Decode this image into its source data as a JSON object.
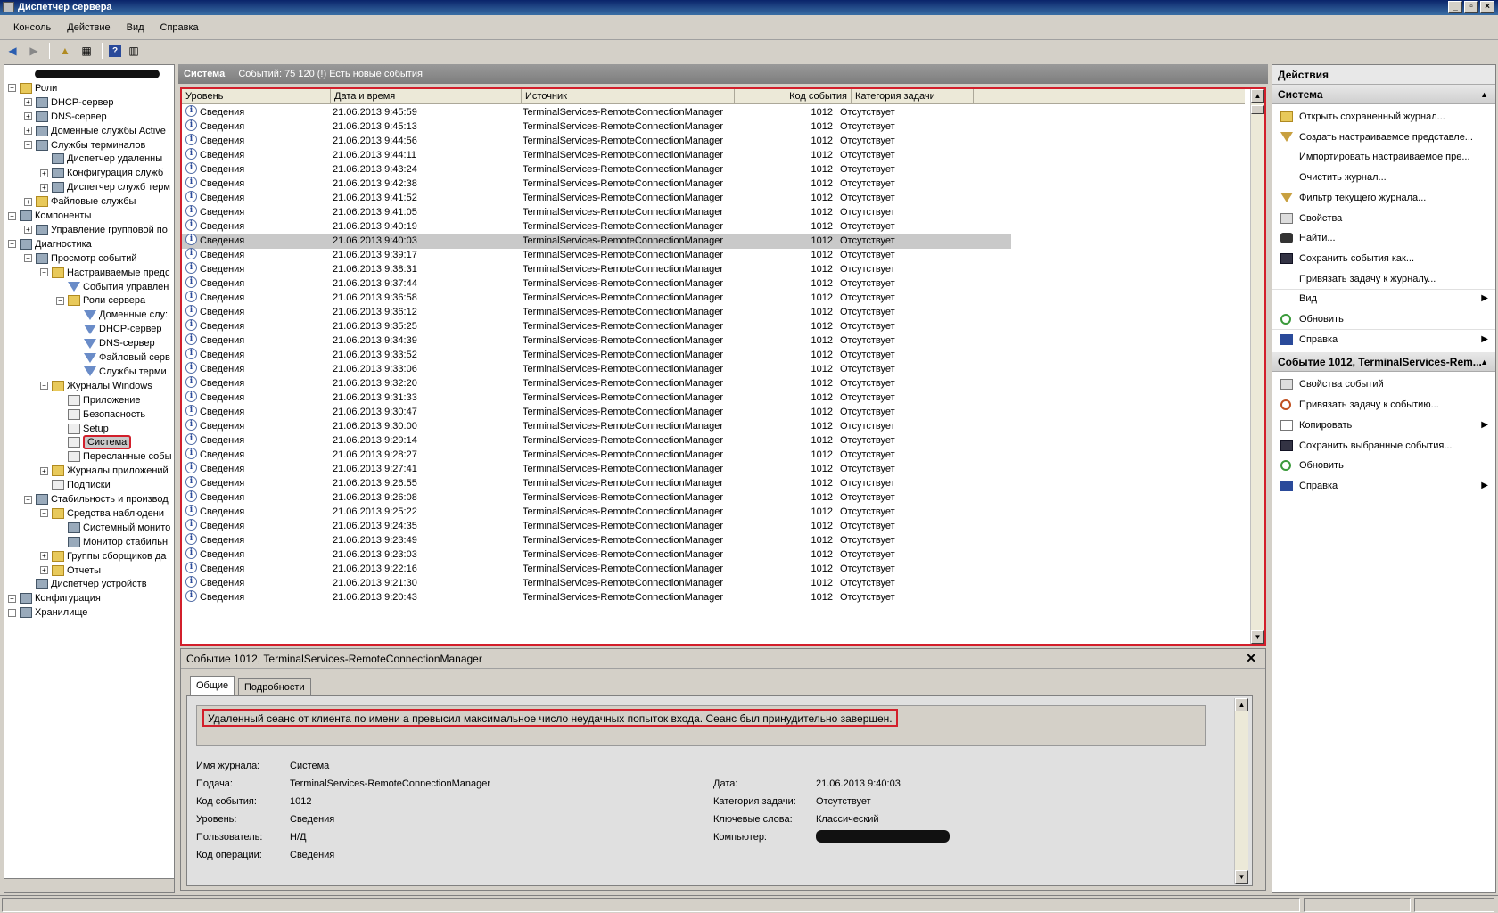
{
  "window": {
    "title": "Диспетчер сервера"
  },
  "menu": [
    "Консоль",
    "Действие",
    "Вид",
    "Справка"
  ],
  "tree": [
    {
      "label": "",
      "depth": 0,
      "pm": "",
      "icon": "server",
      "redacted": true
    },
    {
      "label": "Роли",
      "depth": 0,
      "pm": "−",
      "icon": "folder"
    },
    {
      "label": "DHCP-сервер",
      "depth": 1,
      "pm": "+",
      "icon": "comp"
    },
    {
      "label": "DNS-сервер",
      "depth": 1,
      "pm": "+",
      "icon": "comp"
    },
    {
      "label": "Доменные службы Active",
      "depth": 1,
      "pm": "+",
      "icon": "comp"
    },
    {
      "label": "Службы терминалов",
      "depth": 1,
      "pm": "−",
      "icon": "comp"
    },
    {
      "label": "Диспетчер удаленны",
      "depth": 2,
      "pm": "",
      "icon": "comp"
    },
    {
      "label": "Конфигурация служб",
      "depth": 2,
      "pm": "+",
      "icon": "comp"
    },
    {
      "label": "Диспетчер служб терм",
      "depth": 2,
      "pm": "+",
      "icon": "comp"
    },
    {
      "label": "Файловые службы",
      "depth": 1,
      "pm": "+",
      "icon": "folder"
    },
    {
      "label": "Компоненты",
      "depth": 0,
      "pm": "−",
      "icon": "comp"
    },
    {
      "label": "Управление групповой по",
      "depth": 1,
      "pm": "+",
      "icon": "comp"
    },
    {
      "label": "Диагностика",
      "depth": 0,
      "pm": "−",
      "icon": "comp"
    },
    {
      "label": "Просмотр событий",
      "depth": 1,
      "pm": "−",
      "icon": "comp"
    },
    {
      "label": "Настраиваемые предс",
      "depth": 2,
      "pm": "−",
      "icon": "folder"
    },
    {
      "label": "События управлен",
      "depth": 3,
      "pm": "",
      "icon": "filter"
    },
    {
      "label": "Роли сервера",
      "depth": 3,
      "pm": "−",
      "icon": "folder"
    },
    {
      "label": "Доменные слу:",
      "depth": 4,
      "pm": "",
      "icon": "filter"
    },
    {
      "label": "DHCP-сервер",
      "depth": 4,
      "pm": "",
      "icon": "filter"
    },
    {
      "label": "DNS-сервер",
      "depth": 4,
      "pm": "",
      "icon": "filter"
    },
    {
      "label": "Файловый серв",
      "depth": 4,
      "pm": "",
      "icon": "filter"
    },
    {
      "label": "Службы терми",
      "depth": 4,
      "pm": "",
      "icon": "filter"
    },
    {
      "label": "Журналы Windows",
      "depth": 2,
      "pm": "−",
      "icon": "folder"
    },
    {
      "label": "Приложение",
      "depth": 3,
      "pm": "",
      "icon": "log"
    },
    {
      "label": "Безопасность",
      "depth": 3,
      "pm": "",
      "icon": "log"
    },
    {
      "label": "Setup",
      "depth": 3,
      "pm": "",
      "icon": "log"
    },
    {
      "label": "Система",
      "depth": 3,
      "pm": "",
      "icon": "log",
      "selected": true
    },
    {
      "label": "Пересланные собы",
      "depth": 3,
      "pm": "",
      "icon": "log"
    },
    {
      "label": "Журналы приложений",
      "depth": 2,
      "pm": "+",
      "icon": "folder"
    },
    {
      "label": "Подписки",
      "depth": 2,
      "pm": "",
      "icon": "log"
    },
    {
      "label": "Стабильность и производ",
      "depth": 1,
      "pm": "−",
      "icon": "comp"
    },
    {
      "label": "Средства наблюдени",
      "depth": 2,
      "pm": "−",
      "icon": "folder"
    },
    {
      "label": "Системный монито",
      "depth": 3,
      "pm": "",
      "icon": "comp"
    },
    {
      "label": "Монитор стабильн",
      "depth": 3,
      "pm": "",
      "icon": "comp"
    },
    {
      "label": "Группы сборщиков да",
      "depth": 2,
      "pm": "+",
      "icon": "folder"
    },
    {
      "label": "Отчеты",
      "depth": 2,
      "pm": "+",
      "icon": "folder"
    },
    {
      "label": "Диспетчер устройств",
      "depth": 1,
      "pm": "",
      "icon": "comp"
    },
    {
      "label": "Конфигурация",
      "depth": 0,
      "pm": "+",
      "icon": "comp"
    },
    {
      "label": "Хранилище",
      "depth": 0,
      "pm": "+",
      "icon": "comp"
    }
  ],
  "center_header": {
    "title": "Система",
    "info": "Событий: 75 120 (!) Есть новые события"
  },
  "grid": {
    "columns": [
      "Уровень",
      "Дата и время",
      "Источник",
      "Код события",
      "Категория задачи"
    ],
    "level": "Сведения",
    "source": "TerminalServices-RemoteConnectionManager",
    "event_id": "1012",
    "category": "Отсутствует",
    "times": [
      "21.06.2013 9:45:59",
      "21.06.2013 9:45:13",
      "21.06.2013 9:44:56",
      "21.06.2013 9:44:11",
      "21.06.2013 9:43:24",
      "21.06.2013 9:42:38",
      "21.06.2013 9:41:52",
      "21.06.2013 9:41:05",
      "21.06.2013 9:40:19",
      "21.06.2013 9:40:03",
      "21.06.2013 9:39:17",
      "21.06.2013 9:38:31",
      "21.06.2013 9:37:44",
      "21.06.2013 9:36:58",
      "21.06.2013 9:36:12",
      "21.06.2013 9:35:25",
      "21.06.2013 9:34:39",
      "21.06.2013 9:33:52",
      "21.06.2013 9:33:06",
      "21.06.2013 9:32:20",
      "21.06.2013 9:31:33",
      "21.06.2013 9:30:47",
      "21.06.2013 9:30:00",
      "21.06.2013 9:29:14",
      "21.06.2013 9:28:27",
      "21.06.2013 9:27:41",
      "21.06.2013 9:26:55",
      "21.06.2013 9:26:08",
      "21.06.2013 9:25:22",
      "21.06.2013 9:24:35",
      "21.06.2013 9:23:49",
      "21.06.2013 9:23:03",
      "21.06.2013 9:22:16",
      "21.06.2013 9:21:30",
      "21.06.2013 9:20:43"
    ],
    "selected_index": 9
  },
  "detail": {
    "title": "Событие 1012, TerminalServices-RemoteConnectionManager",
    "tabs": [
      "Общие",
      "Подробности"
    ],
    "message": "Удаленный сеанс от клиента по имени a превысил максимальное число неудачных попыток входа. Сеанс был принудительно завершен.",
    "fields": {
      "log_name_label": "Имя журнала:",
      "log_name": "Система",
      "source_label": "Подача:",
      "source": "TerminalServices-RemoteConnectionManager",
      "event_id_label": "Код события:",
      "event_id": "1012",
      "level_label": "Уровень:",
      "level": "Сведения",
      "user_label": "Пользователь:",
      "user": "Н/Д",
      "opcode_label": "Код операции:",
      "opcode": "Сведения",
      "date_label": "Дата:",
      "date": "21.06.2013 9:40:03",
      "category_label": "Категория задачи:",
      "category": "Отсутствует",
      "keywords_label": "Ключевые слова:",
      "keywords": "Классический",
      "computer_label": "Компьютер:"
    }
  },
  "actions": {
    "header": "Действия",
    "section1": "Система",
    "items1": [
      {
        "label": "Открыть сохраненный журнал...",
        "icon": "open-folder-icon",
        "sub": false
      },
      {
        "label": "Создать настраиваемое представле...",
        "icon": "filter-icon",
        "sub": false
      },
      {
        "label": "Импортировать настраиваемое пре...",
        "icon": "",
        "sub": false
      },
      {
        "label": "Очистить журнал...",
        "icon": "",
        "sub": false
      },
      {
        "label": "Фильтр текущего журнала...",
        "icon": "filter-icon",
        "sub": false
      },
      {
        "label": "Свойства",
        "icon": "properties-icon",
        "sub": false
      },
      {
        "label": "Найти...",
        "icon": "binoculars-icon",
        "sub": false
      },
      {
        "label": "Сохранить события как...",
        "icon": "save-icon",
        "sub": false
      },
      {
        "label": "Привязать задачу к журналу...",
        "icon": "",
        "sub": false
      },
      {
        "label": "Вид",
        "icon": "",
        "sub": true
      },
      {
        "label": "Обновить",
        "icon": "refresh-icon",
        "sub": false
      },
      {
        "label": "Справка",
        "icon": "help-icon",
        "sub": true
      }
    ],
    "section2": "Событие 1012, TerminalServices-Rem...",
    "items2": [
      {
        "label": "Свойства событий",
        "icon": "properties-icon",
        "sub": false
      },
      {
        "label": "Привязать задачу к событию...",
        "icon": "clock-icon",
        "sub": false
      },
      {
        "label": "Копировать",
        "icon": "copy-icon",
        "sub": true
      },
      {
        "label": "Сохранить выбранные события...",
        "icon": "save-icon",
        "sub": false
      },
      {
        "label": "Обновить",
        "icon": "refresh-icon",
        "sub": false
      },
      {
        "label": "Справка",
        "icon": "help-icon",
        "sub": true
      }
    ]
  },
  "colors": {
    "highlight_red": "#d21f2b",
    "title_blue": "#0a246a",
    "selected_row": "#c9c9c9"
  }
}
